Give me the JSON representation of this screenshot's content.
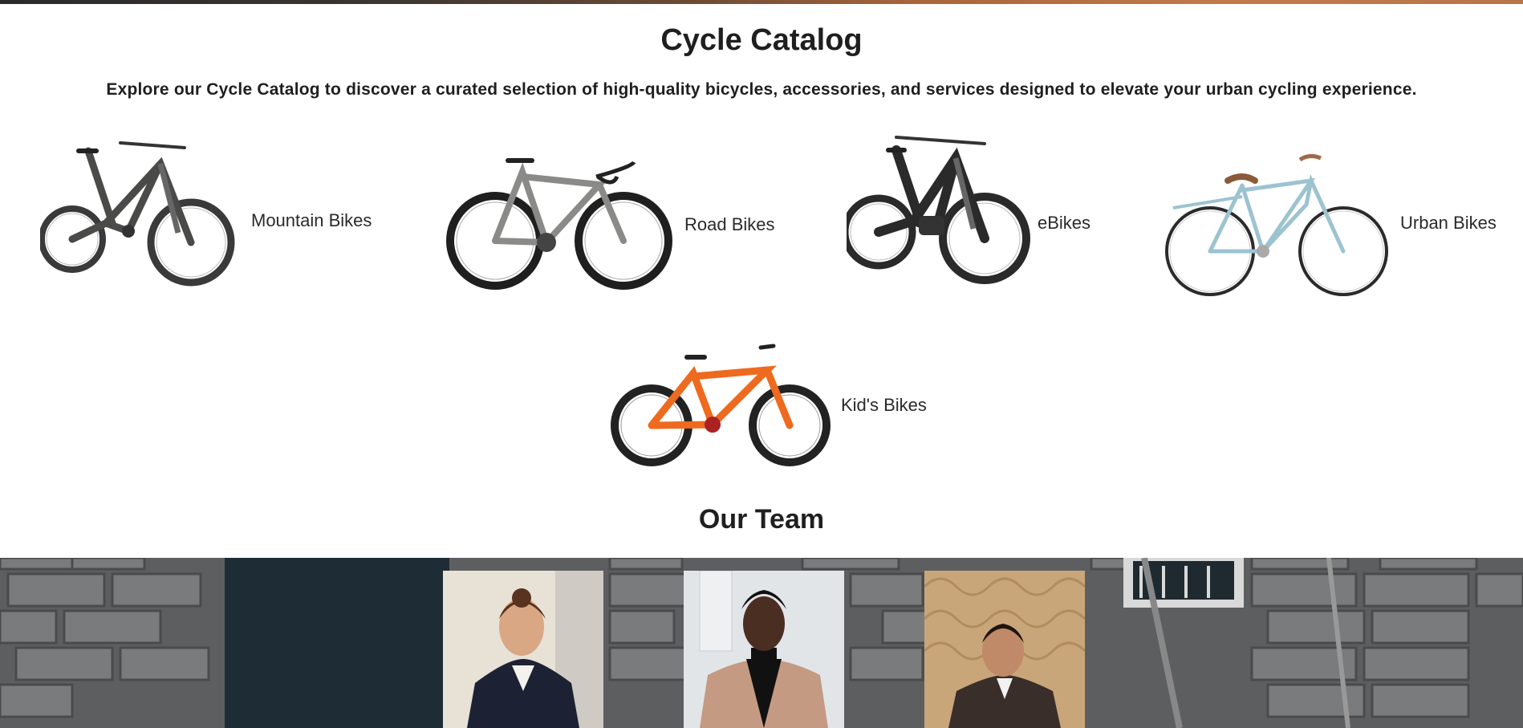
{
  "catalog": {
    "title": "Cycle Catalog",
    "description": "Explore our Cycle Catalog to discover a curated selection of high-quality bicycles, accessories, and services designed to elevate your urban cycling experience.",
    "categories": [
      {
        "label": "Mountain Bikes",
        "icon": "mountain-bike-image",
        "frame_color": "#4a4a48"
      },
      {
        "label": "Road Bikes",
        "icon": "road-bike-image",
        "frame_color": "#8a8a88"
      },
      {
        "label": "eBikes",
        "icon": "ebike-image",
        "frame_color": "#2a2a2a"
      },
      {
        "label": "Urban Bikes",
        "icon": "urban-bike-image",
        "frame_color": "#9cc3d0"
      },
      {
        "label": "Kid's Bikes",
        "icon": "kids-bike-image",
        "frame_color": "#ee6a1f"
      }
    ]
  },
  "team": {
    "title": "Our Team",
    "members": [
      {
        "photo": "team-member-photo-woman",
        "suit_color": "#1c2233"
      },
      {
        "photo": "team-member-photo-man",
        "suit_color": "#c59a82"
      },
      {
        "photo": "team-member-photo-man-2",
        "suit_color": "#3a2e2a"
      }
    ]
  }
}
